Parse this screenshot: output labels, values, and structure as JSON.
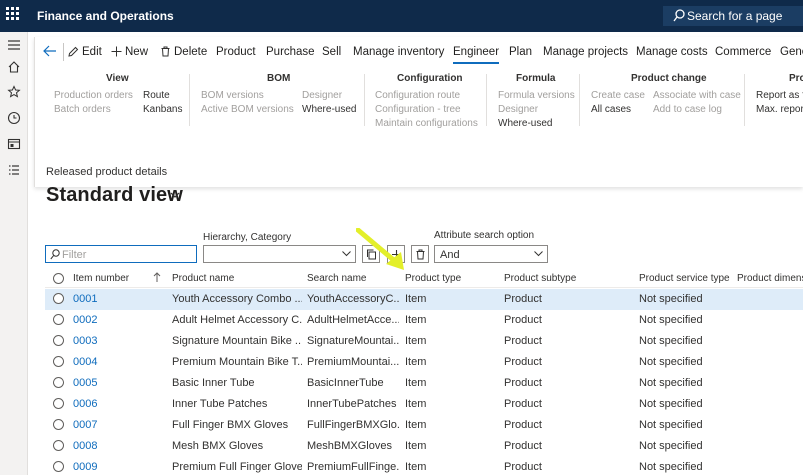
{
  "app": {
    "title": "Finance and Operations",
    "search_label": "Search for a page"
  },
  "toolbar": {
    "edit": "Edit",
    "new": "New",
    "delete": "Delete",
    "tabs": [
      "Product",
      "Purchase",
      "Sell",
      "Manage inventory",
      "Engineer",
      "Plan",
      "Manage projects",
      "Manage costs",
      "Commerce",
      "Gene"
    ],
    "active_tab": "Engineer"
  },
  "ribbon": {
    "view": {
      "title": "View",
      "items": [
        "Production orders",
        "Batch orders",
        "Route",
        "Kanbans"
      ]
    },
    "bom": {
      "title": "BOM",
      "items": [
        "BOM versions",
        "Active BOM versions",
        "Designer",
        "Where-used"
      ]
    },
    "configuration": {
      "title": "Configuration",
      "items": [
        "Configuration route",
        "Configuration - tree",
        "Maintain configurations"
      ]
    },
    "formula": {
      "title": "Formula",
      "items": [
        "Formula versions",
        "Designer",
        "Where-used"
      ]
    },
    "product_change": {
      "title": "Product change",
      "items": [
        "Create case",
        "All cases",
        "Associate with case",
        "Add to case log"
      ]
    },
    "pro": {
      "title": "Pro",
      "items": [
        "Report as fi",
        "Max. report"
      ]
    }
  },
  "page": {
    "breadcrumb": "Released product details",
    "view_name": "Standard view"
  },
  "filters": {
    "filter_placeholder": "Filter",
    "hierarchy_label": "Hierarchy, Category",
    "hierarchy_value": "",
    "attribute_label": "Attribute search option",
    "attribute_value": "And"
  },
  "grid": {
    "columns": [
      "Item number",
      "Product name",
      "Search name",
      "Product type",
      "Product subtype",
      "Product service type",
      "Product dimens"
    ],
    "rows": [
      [
        "0001",
        "Youth Accessory Combo ...",
        "YouthAccessoryC...",
        "Item",
        "Product",
        "Not specified"
      ],
      [
        "0002",
        "Adult Helmet Accessory C...",
        "AdultHelmetAcce...",
        "Item",
        "Product",
        "Not specified"
      ],
      [
        "0003",
        "Signature Mountain Bike ...",
        "SignatureMountai...",
        "Item",
        "Product",
        "Not specified"
      ],
      [
        "0004",
        "Premium Mountain Bike T...",
        "PremiumMountai...",
        "Item",
        "Product",
        "Not specified"
      ],
      [
        "0005",
        "Basic Inner Tube",
        "BasicInnerTube",
        "Item",
        "Product",
        "Not specified"
      ],
      [
        "0006",
        "Inner Tube Patches",
        "InnerTubePatches",
        "Item",
        "Product",
        "Not specified"
      ],
      [
        "0007",
        "Full Finger BMX Gloves",
        "FullFingerBMXGlo...",
        "Item",
        "Product",
        "Not specified"
      ],
      [
        "0008",
        "Mesh BMX Gloves",
        "MeshBMXGloves",
        "Item",
        "Product",
        "Not specified"
      ],
      [
        "0009",
        "Premium Full Finger Gloves",
        "PremiumFullFinge...",
        "Item",
        "Product",
        "Not specified"
      ]
    ]
  },
  "colors": {
    "topbar": "#0f2a4a",
    "accent": "#0f6cbd",
    "selected_row": "#deecf9",
    "annotation_arrow": "#e3ef2a"
  }
}
